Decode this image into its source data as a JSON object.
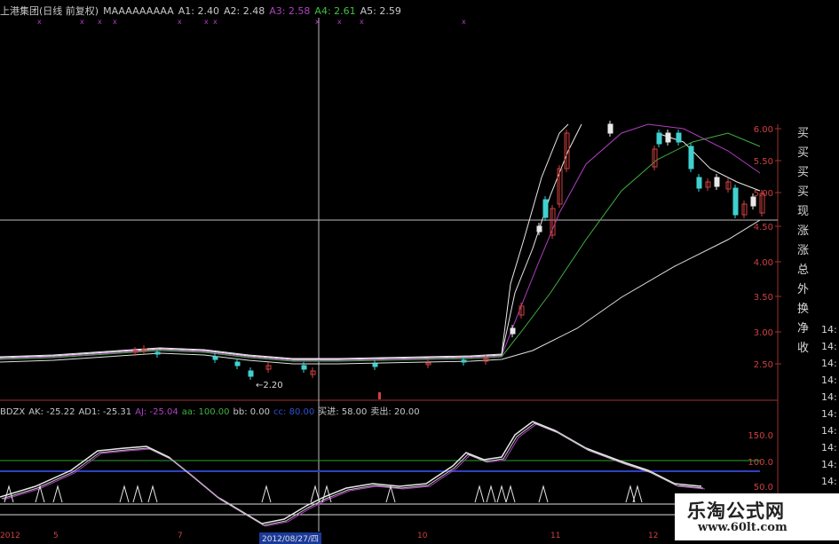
{
  "header": {
    "stock": "上港集团(日线 前复权)",
    "formula": "MAAAAAAAAA",
    "a1": "A1: 2.40",
    "a2": "A2: 2.48",
    "a3": "A3: 2.58",
    "a4": "A4: 2.61",
    "a5": "A5: 2.59",
    "colors": {
      "a1": "#c8c8c8",
      "a2": "#c8c8c8",
      "a3": "#b040c0",
      "a4": "#40c040",
      "a5": "#c8c8c8"
    }
  },
  "indicator_header": {
    "name": "BDZX",
    "ak": "AK: -25.22",
    "ad1": "AD1: -25.31",
    "aj": "AJ: -25.04",
    "aa": "aa: 100.00",
    "bb": "bb: 0.00",
    "cc": "cc: 80.00",
    "buy": "买进: 58.00",
    "sell": "卖出: 20.00"
  },
  "price_axis": [
    "6.00",
    "5.50",
    "5.00",
    "4.50",
    "4.00",
    "3.50",
    "3.00",
    "2.50"
  ],
  "indicator_axis": [
    "150.0",
    "100.0",
    "50.0"
  ],
  "low_marker": "2.20",
  "side_tabs": [
    "买",
    "买",
    "买",
    "买",
    "现",
    "涨",
    "涨",
    "总",
    "外",
    "换",
    "净",
    "收"
  ],
  "right_time_labels": [
    "14:",
    "14:",
    "14:",
    "14:",
    "14:",
    "14:",
    "14:",
    "14:",
    "14:",
    "14:",
    "14:",
    "14:"
  ],
  "date_label": "2012/08/27/四",
  "watermark": {
    "name": "乐淘公式网",
    "url": "www.60lt.com"
  },
  "colors": {
    "red": "#d04040",
    "cyan": "#40d0d0",
    "white": "#e8e8e8",
    "magenta": "#b040c0",
    "green": "#40b040",
    "blue": "#3040c0"
  }
}
